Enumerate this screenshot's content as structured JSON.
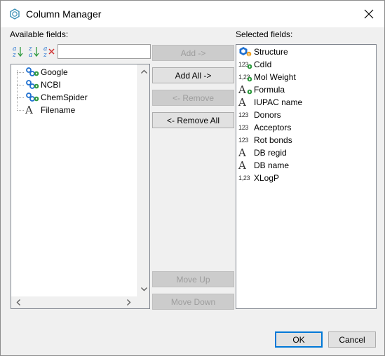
{
  "window": {
    "title": "Column Manager",
    "title_icon": "benzene-icon",
    "close_icon": "close-icon"
  },
  "labels": {
    "available": "Available fields:",
    "selected": "Selected fields:"
  },
  "toolbar": {
    "sort_asc_label": "a↓z",
    "sort_desc_label": "z↓a",
    "clear_sort_label": "a×z",
    "filter_value": "",
    "filter_placeholder": ""
  },
  "available_fields": [
    {
      "label": "Google",
      "icon": "web-link-icon"
    },
    {
      "label": "NCBI",
      "icon": "web-link-icon"
    },
    {
      "label": "ChemSpider",
      "icon": "web-link-icon"
    },
    {
      "label": "Filename",
      "icon": "text-type-icon"
    }
  ],
  "buttons": {
    "add": "Add ->",
    "add_all": "Add All ->",
    "remove": "<- Remove",
    "remove_all": "<- Remove All",
    "move_up": "Move Up",
    "move_down": "Move Down",
    "ok": "OK",
    "cancel": "Cancel"
  },
  "selected_fields": [
    {
      "label": "Structure",
      "icon": "structure-icon"
    },
    {
      "label": "CdId",
      "icon": "integer-calculated-icon"
    },
    {
      "label": "Mol Weight",
      "icon": "decimal-calculated-icon"
    },
    {
      "label": "Formula",
      "icon": "text-calculated-icon"
    },
    {
      "label": "IUPAC name",
      "icon": "text-type-icon"
    },
    {
      "label": "Donors",
      "icon": "integer-type-icon"
    },
    {
      "label": "Acceptors",
      "icon": "integer-type-icon"
    },
    {
      "label": "Rot bonds",
      "icon": "integer-type-icon"
    },
    {
      "label": "DB regid",
      "icon": "text-type-icon"
    },
    {
      "label": "DB name",
      "icon": "text-type-icon"
    },
    {
      "label": "XLogP",
      "icon": "decimal-type-icon"
    }
  ],
  "icon_glyphs": {
    "integer": "123",
    "decimal": "1,23",
    "text": "A"
  },
  "colors": {
    "link_blue": "#1e6fcf",
    "calc_green": "#2e9a3e",
    "structure_orange": "#f0a020",
    "accent": "#0078d7"
  }
}
